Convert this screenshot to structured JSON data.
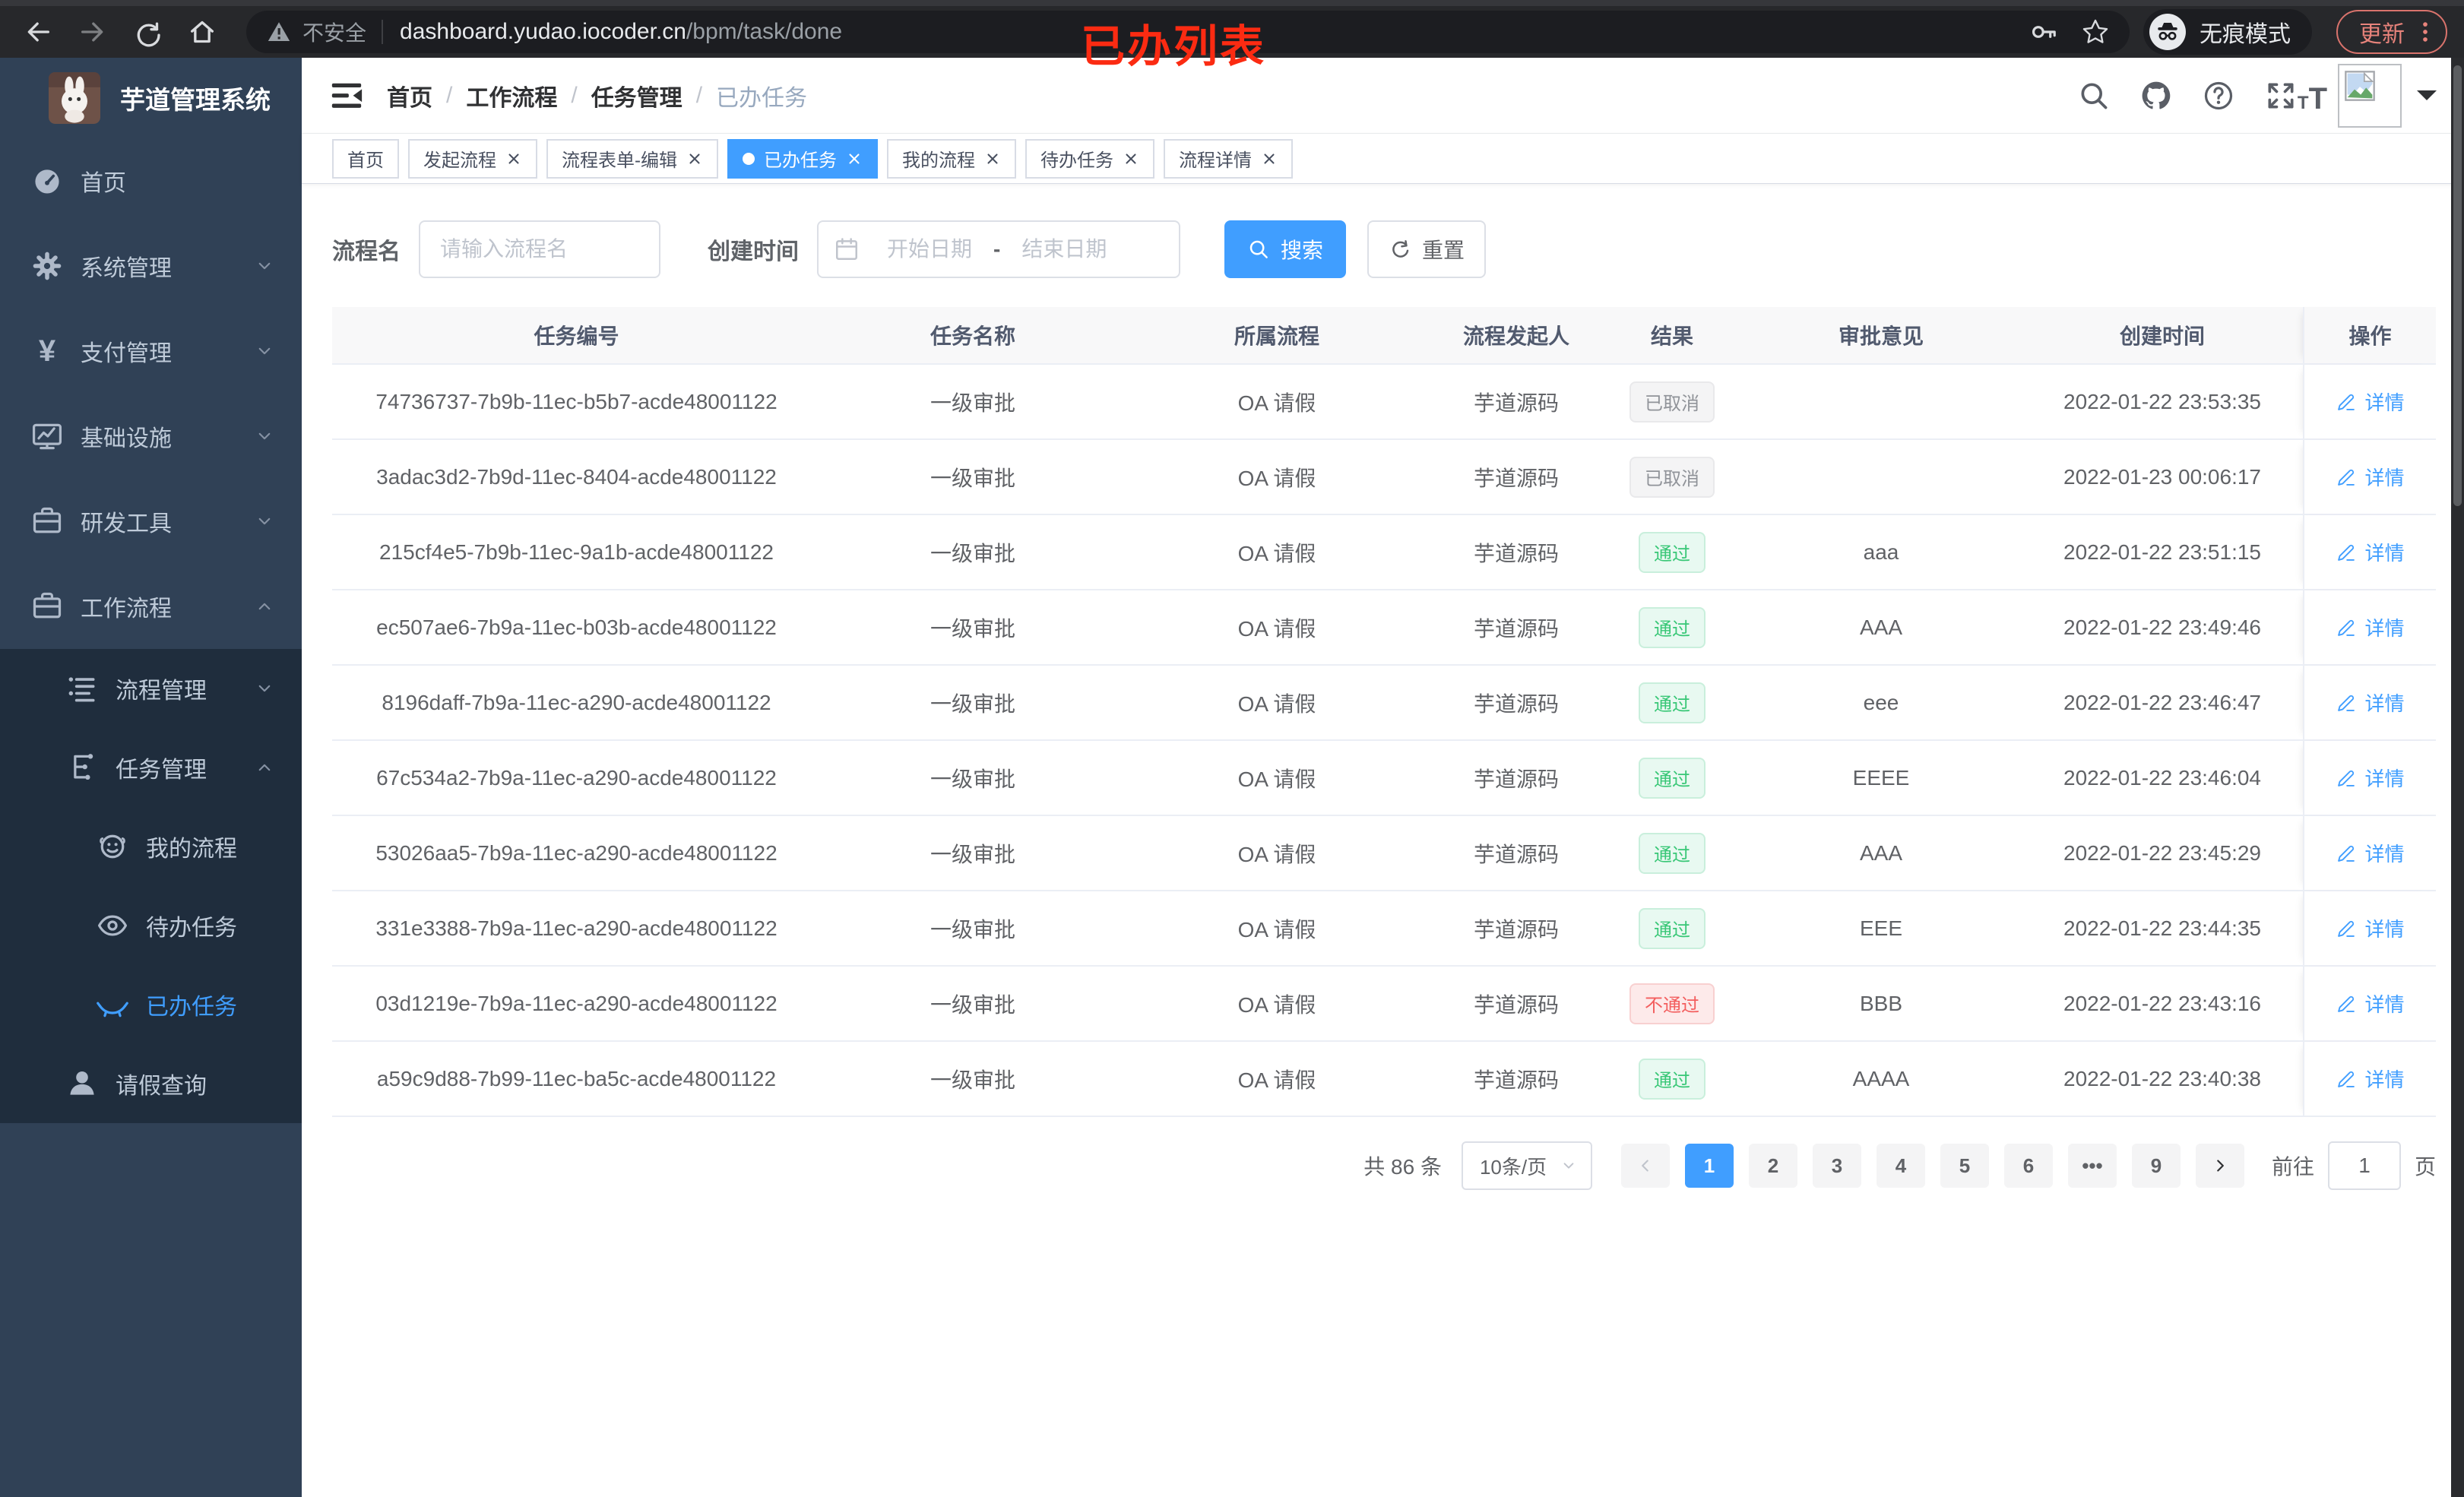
{
  "browser": {
    "security_label": "不安全",
    "url_host": "dashboard.yudao.iocoder.cn",
    "url_path": "/bpm/task/done",
    "incognito_label": "无痕模式",
    "update_label": "更新",
    "annotation": "已办列表"
  },
  "sidebar": {
    "app_title": "芋道管理系统",
    "items": [
      {
        "label": "首页",
        "icon": "dashboard",
        "level": 1
      },
      {
        "label": "系统管理",
        "icon": "gear",
        "level": 1,
        "arrow": "chevron-down"
      },
      {
        "label": "支付管理",
        "icon": "yen",
        "level": 1,
        "arrow": "chevron-down"
      },
      {
        "label": "基础设施",
        "icon": "monitor",
        "level": 1,
        "arrow": "chevron-down"
      },
      {
        "label": "研发工具",
        "icon": "briefcase",
        "level": 1,
        "arrow": "chevron-down"
      },
      {
        "label": "工作流程",
        "icon": "briefcase",
        "level": 1,
        "arrow": "chevron-up"
      },
      {
        "label": "流程管理",
        "icon": "tree-list",
        "level": 2,
        "sub": true,
        "arrow": "chevron-down"
      },
      {
        "label": "任务管理",
        "icon": "org-tree",
        "level": 2,
        "sub": true,
        "arrow": "chevron-up"
      },
      {
        "label": "我的流程",
        "icon": "people",
        "level": 3,
        "sub": true
      },
      {
        "label": "待办任务",
        "icon": "eye-open",
        "level": 3,
        "sub": true
      },
      {
        "label": "已办任务",
        "icon": "eye-closed",
        "level": 3,
        "sub": true,
        "active": true
      },
      {
        "label": "请假查询",
        "icon": "user",
        "level": 2,
        "sub": true
      }
    ]
  },
  "navbar": {
    "breadcrumb": [
      {
        "label": "首页",
        "sep": "/"
      },
      {
        "label": "工作流程",
        "sep": "/"
      },
      {
        "label": "任务管理",
        "sep": "/"
      },
      {
        "label": "已办任务",
        "current": true
      }
    ],
    "tools": [
      {
        "icon": "search"
      },
      {
        "icon": "github"
      },
      {
        "icon": "help"
      },
      {
        "icon": "fullscreen"
      }
    ]
  },
  "tabs": [
    {
      "label": "首页"
    },
    {
      "label": "发起流程",
      "closable": true
    },
    {
      "label": "流程表单-编辑",
      "closable": true
    },
    {
      "label": "已办任务",
      "closable": true,
      "active": true
    },
    {
      "label": "我的流程",
      "closable": true
    },
    {
      "label": "待办任务",
      "closable": true
    },
    {
      "label": "流程详情",
      "closable": true
    }
  ],
  "filters": {
    "name_label": "流程名",
    "name_placeholder": "请输入流程名",
    "time_label": "创建时间",
    "start_placeholder": "开始日期",
    "range_separator": "-",
    "end_placeholder": "结束日期",
    "search_label": "搜索",
    "reset_label": "重置"
  },
  "table": {
    "columns": [
      "任务编号",
      "任务名称",
      "所属流程",
      "流程发起人",
      "结果",
      "审批意见",
      "创建时间",
      "操作"
    ],
    "detail_label": "详情",
    "rows": [
      {
        "id": "74736737-7b9b-11ec-b5b7-acde48001122",
        "name": "一级审批",
        "process": "OA 请假",
        "starter": "芋道源码",
        "result": "已取消",
        "result_type": "info",
        "comment": "",
        "created": "2022-01-22 23:53:35"
      },
      {
        "id": "3adac3d2-7b9d-11ec-8404-acde48001122",
        "name": "一级审批",
        "process": "OA 请假",
        "starter": "芋道源码",
        "result": "已取消",
        "result_type": "info",
        "comment": "",
        "created": "2022-01-23 00:06:17"
      },
      {
        "id": "215cf4e5-7b9b-11ec-9a1b-acde48001122",
        "name": "一级审批",
        "process": "OA 请假",
        "starter": "芋道源码",
        "result": "通过",
        "result_type": "success",
        "comment": "aaa",
        "created": "2022-01-22 23:51:15"
      },
      {
        "id": "ec507ae6-7b9a-11ec-b03b-acde48001122",
        "name": "一级审批",
        "process": "OA 请假",
        "starter": "芋道源码",
        "result": "通过",
        "result_type": "success",
        "comment": "AAA",
        "created": "2022-01-22 23:49:46"
      },
      {
        "id": "8196daff-7b9a-11ec-a290-acde48001122",
        "name": "一级审批",
        "process": "OA 请假",
        "starter": "芋道源码",
        "result": "通过",
        "result_type": "success",
        "comment": "eee",
        "created": "2022-01-22 23:46:47"
      },
      {
        "id": "67c534a2-7b9a-11ec-a290-acde48001122",
        "name": "一级审批",
        "process": "OA 请假",
        "starter": "芋道源码",
        "result": "通过",
        "result_type": "success",
        "comment": "EEEE",
        "created": "2022-01-22 23:46:04"
      },
      {
        "id": "53026aa5-7b9a-11ec-a290-acde48001122",
        "name": "一级审批",
        "process": "OA 请假",
        "starter": "芋道源码",
        "result": "通过",
        "result_type": "success",
        "comment": "AAA",
        "created": "2022-01-22 23:45:29"
      },
      {
        "id": "331e3388-7b9a-11ec-a290-acde48001122",
        "name": "一级审批",
        "process": "OA 请假",
        "starter": "芋道源码",
        "result": "通过",
        "result_type": "success",
        "comment": "EEE",
        "created": "2022-01-22 23:44:35"
      },
      {
        "id": "03d1219e-7b9a-11ec-a290-acde48001122",
        "name": "一级审批",
        "process": "OA 请假",
        "starter": "芋道源码",
        "result": "不通过",
        "result_type": "danger",
        "comment": "BBB",
        "created": "2022-01-22 23:43:16"
      },
      {
        "id": "a59c9d88-7b99-11ec-ba5c-acde48001122",
        "name": "一级审批",
        "process": "OA 请假",
        "starter": "芋道源码",
        "result": "通过",
        "result_type": "success",
        "comment": "AAAA",
        "created": "2022-01-22 23:40:38"
      }
    ]
  },
  "pagination": {
    "total_label": "共 86 条",
    "page_size_label": "10条/页",
    "pages": [
      {
        "label": "1",
        "active": true
      },
      {
        "label": "2"
      },
      {
        "label": "3"
      },
      {
        "label": "4"
      },
      {
        "label": "5"
      },
      {
        "label": "6"
      },
      {
        "label": "•••"
      },
      {
        "label": "9"
      }
    ],
    "goto_label": "前往",
    "goto_value": "1",
    "page_unit_label": "页"
  },
  "colors": {
    "primary": "#409eff",
    "success": "#38c776",
    "danger": "#f35e5e",
    "info": "#909399",
    "sidebar_bg": "#304156",
    "submenu_bg": "#1f2d3d",
    "annotation": "#fb2b12"
  },
  "icons": [
    "back",
    "forward",
    "reload",
    "home",
    "warning",
    "key",
    "star",
    "incognito",
    "kebab",
    "hamburger",
    "search",
    "github",
    "help",
    "fullscreen",
    "text-size",
    "broken-image",
    "caret-down",
    "dashboard",
    "gear",
    "yen",
    "monitor",
    "briefcase",
    "tree-list",
    "org-tree",
    "people",
    "eye-open",
    "eye-closed",
    "user",
    "chevron-down",
    "chevron-up",
    "chevron-left",
    "chevron-right",
    "calendar",
    "close",
    "pen",
    "refresh",
    "rabbit-logo"
  ]
}
